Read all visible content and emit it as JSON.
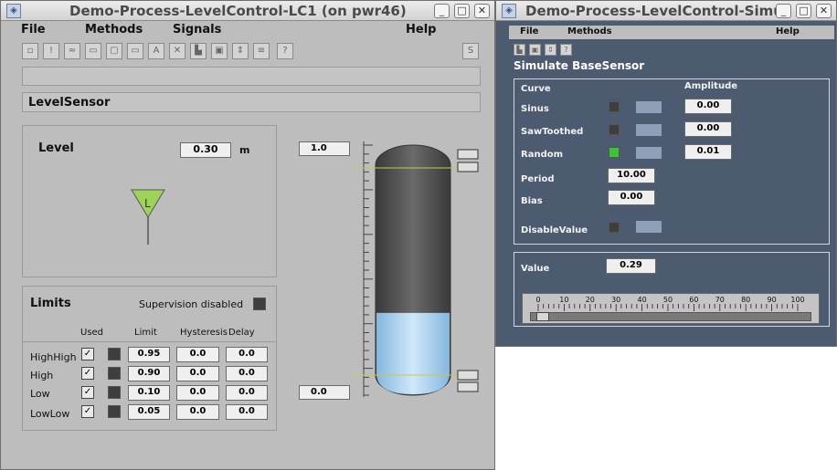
{
  "window1": {
    "title": "Demo-Process-LevelControl-LC1 (on pwr46)",
    "menus": [
      "File",
      "Methods",
      "Signals",
      "Help"
    ],
    "object_name": "LevelSensor",
    "level": {
      "label": "Level",
      "value": "0.30",
      "unit": "m",
      "fraction": 0.3
    },
    "tank_scale": {
      "max": "1.0",
      "min": "0.0"
    },
    "limits": {
      "title": "Limits",
      "supervision": "Supervision disabled",
      "headers": {
        "used": "Used",
        "limit": "Limit",
        "hysteresis": "Hysteresis",
        "delay": "Delay"
      },
      "rows": [
        {
          "name": "HighHigh",
          "limit": "0.95",
          "hysteresis": "0.0",
          "delay": "0.0"
        },
        {
          "name": "High",
          "limit": "0.90",
          "hysteresis": "0.0",
          "delay": "0.0"
        },
        {
          "name": "Low",
          "limit": "0.10",
          "hysteresis": "0.0",
          "delay": "0.0"
        },
        {
          "name": "LowLow",
          "limit": "0.05",
          "hysteresis": "0.0",
          "delay": "0.0"
        }
      ]
    }
  },
  "window2": {
    "title": "Demo-Process-LevelControl-Simul",
    "menus": [
      "File",
      "Methods",
      "Help"
    ],
    "heading": "Simulate BaseSensor",
    "curve_label": "Curve",
    "amplitude_label": "Amplitude",
    "curves": [
      {
        "name": "Sinus",
        "amplitude": "0.00",
        "active": false
      },
      {
        "name": "SawToothed",
        "amplitude": "0.00",
        "active": false
      },
      {
        "name": "Random",
        "amplitude": "0.01",
        "active": true
      }
    ],
    "period": {
      "label": "Period",
      "value": "10.00"
    },
    "bias": {
      "label": "Bias",
      "value": "0.00"
    },
    "disable_value": {
      "label": "DisableValue"
    },
    "value": {
      "label": "Value",
      "value": "0.29"
    },
    "slider": {
      "ticks": [
        "0",
        "10",
        "20",
        "30",
        "40",
        "50",
        "60",
        "70",
        "80",
        "90",
        "100"
      ],
      "position": 2
    }
  },
  "colors": {
    "active_green": "#3cc53c",
    "water": "#a9d2f2",
    "tank": "#4e4e4e",
    "indicator": "#9ed35a"
  }
}
